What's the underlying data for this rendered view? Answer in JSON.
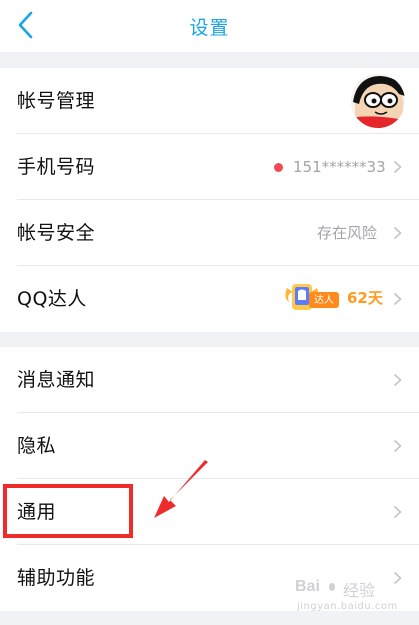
{
  "header": {
    "title": "设置",
    "accent_color": "#18a6e6"
  },
  "section1": {
    "rows": [
      {
        "label": "帐号管理",
        "avatar": "cartoon-avatar"
      },
      {
        "label": "手机号码",
        "value": "151******33",
        "status_dot_color": "#f14a55"
      },
      {
        "label": "帐号安全",
        "value": "存在风险"
      },
      {
        "label": "QQ达人",
        "badge_text": "达人",
        "days": "62天",
        "days_color": "#ff9a1f"
      }
    ]
  },
  "section2": {
    "rows": [
      {
        "label": "消息通知"
      },
      {
        "label": "隐私"
      },
      {
        "label": "通用",
        "highlighted": true
      },
      {
        "label": "辅助功能"
      }
    ]
  },
  "annotation": {
    "box_color": "#ee2c2c",
    "arrow_color": "#ee2c2c"
  },
  "watermark": {
    "brand": "Bai",
    "text": "经验",
    "url": "jingyan.baidu.com"
  }
}
